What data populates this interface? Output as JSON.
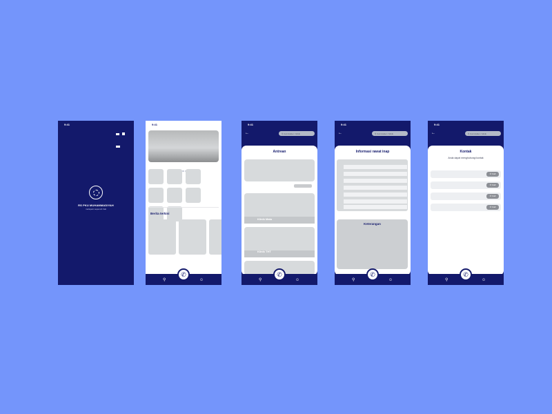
{
  "status": {
    "time": "9:41"
  },
  "splash": {
    "title": "RS PKU MUHAMMADIYAH",
    "subtitle": "melayani sepenuh hati"
  },
  "home": {
    "section_label": "Berita terkini"
  },
  "search": {
    "placeholder": "Cari dokter / klinik"
  },
  "antrean": {
    "title": "Antrean",
    "clinics": [
      "Klinik Mata",
      "Klinik THT"
    ]
  },
  "info": {
    "title": "Informasi rawat inap",
    "keterangan": "Keterangan"
  },
  "kontak": {
    "title": "Kontak",
    "subtitle": "Anda dapat menghubungi kontak",
    "call_label": "Call"
  },
  "icons": {
    "call": "phone-icon",
    "home": "home-icon",
    "profile": "person-icon",
    "back": "arrow-left-icon",
    "search": "search-icon"
  },
  "colors": {
    "background": "#7495fb",
    "navy": "#13196b",
    "placeholder": "#d7dadc"
  }
}
